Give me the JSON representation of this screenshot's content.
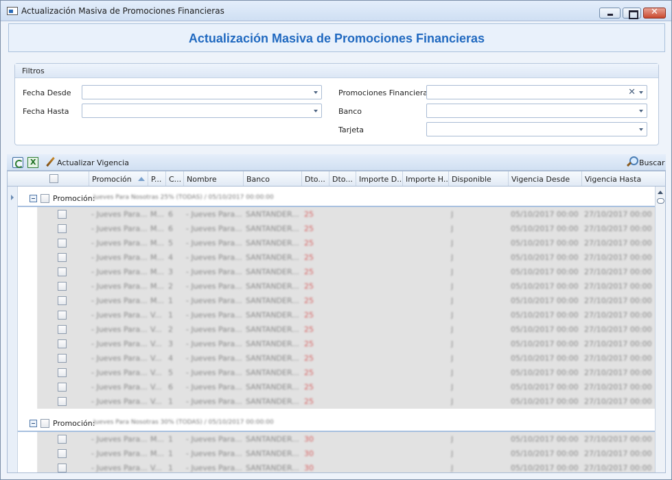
{
  "window": {
    "title": "Actualización Masiva de Promociones Financieras"
  },
  "header": {
    "title": "Actualización Masiva de Promociones Financieras",
    "title_color": "#2069c0"
  },
  "filters": {
    "legend": "Filtros",
    "fecha_desde_label": "Fecha Desde",
    "fecha_hasta_label": "Fecha Hasta",
    "promociones_label": "Promociones Financieras",
    "banco_label": "Banco",
    "tarjeta_label": "Tarjeta"
  },
  "toolbar": {
    "update_label": "Actualizar Vigencia",
    "search_label": "Buscar"
  },
  "grid": {
    "columns": [
      "Promoción",
      "P...",
      "C...",
      "Nombre",
      "Banco",
      "Dto...",
      "Dto...",
      "Importe D...",
      "Importe H...",
      "Disponible",
      "Vigencia Desde",
      "Vigencia Hasta"
    ],
    "sorted_column": "Promoción",
    "groups": [
      {
        "label": "Promoción:",
        "value": "Jueves Para Nosotras 25% (TODAS) / 05/10/2017 00:00:00",
        "rows": [
          [
            "- Jueves Para...",
            "M...",
            "6",
            "- Jueves Para...",
            "SANTANDER...",
            "25",
            "",
            "",
            "",
            "J",
            "05/10/2017 00:00",
            "27/10/2017 00:00"
          ],
          [
            "- Jueves Para...",
            "M...",
            "6",
            "- Jueves Para...",
            "SANTANDER...",
            "25",
            "",
            "",
            "",
            "J",
            "05/10/2017 00:00",
            "27/10/2017 00:00"
          ],
          [
            "- Jueves Para...",
            "M...",
            "5",
            "- Jueves Para...",
            "SANTANDER...",
            "25",
            "",
            "",
            "",
            "J",
            "05/10/2017 00:00",
            "27/10/2017 00:00"
          ],
          [
            "- Jueves Para...",
            "M...",
            "4",
            "- Jueves Para...",
            "SANTANDER...",
            "25",
            "",
            "",
            "",
            "J",
            "05/10/2017 00:00",
            "27/10/2017 00:00"
          ],
          [
            "- Jueves Para...",
            "M...",
            "3",
            "- Jueves Para...",
            "SANTANDER...",
            "25",
            "",
            "",
            "",
            "J",
            "05/10/2017 00:00",
            "27/10/2017 00:00"
          ],
          [
            "- Jueves Para...",
            "M...",
            "2",
            "- Jueves Para...",
            "SANTANDER...",
            "25",
            "",
            "",
            "",
            "J",
            "05/10/2017 00:00",
            "27/10/2017 00:00"
          ],
          [
            "- Jueves Para...",
            "M...",
            "1",
            "- Jueves Para...",
            "SANTANDER...",
            "25",
            "",
            "",
            "",
            "J",
            "05/10/2017 00:00",
            "27/10/2017 00:00"
          ],
          [
            "- Jueves Para...",
            "V...",
            "1",
            "- Jueves Para...",
            "SANTANDER...",
            "25",
            "",
            "",
            "",
            "J",
            "05/10/2017 00:00",
            "27/10/2017 00:00"
          ],
          [
            "- Jueves Para...",
            "V...",
            "2",
            "- Jueves Para...",
            "SANTANDER...",
            "25",
            "",
            "",
            "",
            "J",
            "05/10/2017 00:00",
            "27/10/2017 00:00"
          ],
          [
            "- Jueves Para...",
            "V...",
            "3",
            "- Jueves Para...",
            "SANTANDER...",
            "25",
            "",
            "",
            "",
            "J",
            "05/10/2017 00:00",
            "27/10/2017 00:00"
          ],
          [
            "- Jueves Para...",
            "V...",
            "4",
            "- Jueves Para...",
            "SANTANDER...",
            "25",
            "",
            "",
            "",
            "J",
            "05/10/2017 00:00",
            "27/10/2017 00:00"
          ],
          [
            "- Jueves Para...",
            "V...",
            "5",
            "- Jueves Para...",
            "SANTANDER...",
            "25",
            "",
            "",
            "",
            "J",
            "05/10/2017 00:00",
            "27/10/2017 00:00"
          ],
          [
            "- Jueves Para...",
            "V...",
            "6",
            "- Jueves Para...",
            "SANTANDER...",
            "25",
            "",
            "",
            "",
            "J",
            "05/10/2017 00:00",
            "27/10/2017 00:00"
          ],
          [
            "- Jueves Para...",
            "V...",
            "1",
            "- Jueves Para...",
            "SANTANDER...",
            "25",
            "",
            "",
            "",
            "J",
            "05/10/2017 00:00",
            "27/10/2017 00:00"
          ]
        ]
      },
      {
        "label": "Promoción:",
        "value": "Jueves Para Nosotras 30% (TODAS) / 05/10/2017 00:00:00",
        "rows": [
          [
            "- Jueves Para...",
            "M...",
            "1",
            "- Jueves Para...",
            "SANTANDER...",
            "30",
            "",
            "",
            "",
            "J",
            "05/10/2017 00:00",
            "27/10/2017 00:00"
          ],
          [
            "- Jueves Para...",
            "M...",
            "1",
            "- Jueves Para...",
            "SANTANDER...",
            "30",
            "",
            "",
            "",
            "J",
            "05/10/2017 00:00",
            "27/10/2017 00:00"
          ],
          [
            "- Jueves Para...",
            "V...",
            "1",
            "- Jueves Para...",
            "SANTANDER...",
            "30",
            "",
            "",
            "",
            "J",
            "05/10/2017 00:00",
            "27/10/2017 00:00"
          ]
        ]
      }
    ]
  }
}
